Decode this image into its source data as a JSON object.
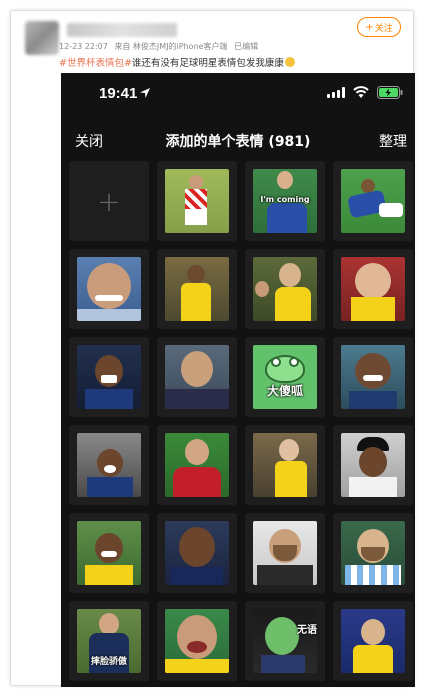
{
  "post": {
    "follow_label": "关注",
    "meta": {
      "time": "12-23 22:07",
      "source": "来自 林俊杰JMJ的iPhone客户端",
      "edited": "已编辑"
    },
    "text": {
      "tag": "#世界杯表情包#",
      "body": "谁还有没有足球明星表情包发我康康"
    }
  },
  "phone": {
    "status": {
      "time": "19:41"
    },
    "nav": {
      "close": "关闭",
      "title": "添加的单个表情 (981)",
      "manage": "整理"
    },
    "stickers": [
      {
        "kind": "add"
      },
      {
        "kind": "sticker",
        "caption": ""
      },
      {
        "kind": "sticker",
        "caption": "I'm coming"
      },
      {
        "kind": "sticker",
        "caption": ""
      },
      {
        "kind": "sticker",
        "caption": ""
      },
      {
        "kind": "sticker",
        "caption": ""
      },
      {
        "kind": "sticker",
        "caption": ""
      },
      {
        "kind": "sticker",
        "caption": ""
      },
      {
        "kind": "sticker",
        "caption": ""
      },
      {
        "kind": "sticker",
        "caption": ""
      },
      {
        "kind": "sticker",
        "caption": "大傻呱"
      },
      {
        "kind": "sticker",
        "caption": ""
      },
      {
        "kind": "sticker",
        "caption": ""
      },
      {
        "kind": "sticker",
        "caption": ""
      },
      {
        "kind": "sticker",
        "caption": ""
      },
      {
        "kind": "sticker",
        "caption": ""
      },
      {
        "kind": "sticker",
        "caption": ""
      },
      {
        "kind": "sticker",
        "caption": ""
      },
      {
        "kind": "sticker",
        "caption": ""
      },
      {
        "kind": "sticker",
        "caption": ""
      },
      {
        "kind": "sticker",
        "caption": "摔脸骄傲"
      },
      {
        "kind": "sticker",
        "caption": ""
      },
      {
        "kind": "sticker",
        "caption": "无语"
      },
      {
        "kind": "sticker",
        "caption": ""
      }
    ]
  },
  "colors": {
    "accent": "#ff8200",
    "topic": "#eb7350",
    "phone_bg": "#121212",
    "cell_bg": "#1e1e1e"
  }
}
